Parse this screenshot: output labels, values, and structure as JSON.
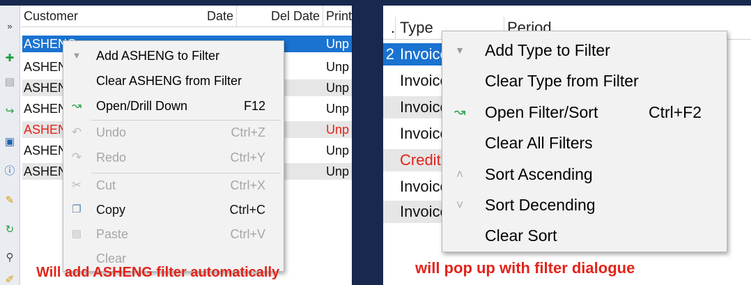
{
  "left": {
    "columns": [
      "Customer",
      "Date",
      "Del Date",
      "Print"
    ],
    "rows": [
      {
        "customer": "ASHENG",
        "print": "Unp",
        "selected": true,
        "red": false
      },
      {
        "customer": "ASHENG",
        "print": "Unp",
        "selected": false,
        "red": false
      },
      {
        "customer": "ASHENG",
        "print": "Unp",
        "selected": false,
        "red": false
      },
      {
        "customer": "ASHENG",
        "print": "Unp",
        "selected": false,
        "red": false
      },
      {
        "customer": "ASHENG",
        "print": "Unp",
        "selected": false,
        "red": true
      },
      {
        "customer": "ASHENG",
        "print": "Unp",
        "selected": false,
        "red": false
      },
      {
        "customer": "ASHENG",
        "print": "Unp",
        "selected": false,
        "red": false
      }
    ],
    "menu": {
      "add_filter": "Add ASHENG to Filter",
      "clear_filter": "Clear ASHENG from Filter",
      "open": "Open/Drill Down",
      "open_key": "F12",
      "undo": "Undo",
      "undo_key": "Ctrl+Z",
      "redo": "Redo",
      "redo_key": "Ctrl+Y",
      "cut": "Cut",
      "cut_key": "Ctrl+X",
      "copy": "Copy",
      "copy_key": "Ctrl+C",
      "paste": "Paste",
      "paste_key": "Ctrl+V",
      "clear": "Clear"
    },
    "caption": "Will add ASHENG filter automatically"
  },
  "right": {
    "columns": [
      ".",
      "Type",
      "Period"
    ],
    "rows": [
      {
        "num": "2",
        "type": "Invoice",
        "selected": true,
        "red": false
      },
      {
        "num": "",
        "type": "Invoice",
        "selected": false,
        "red": false
      },
      {
        "num": "",
        "type": "Invoice",
        "selected": false,
        "red": false
      },
      {
        "num": "",
        "type": "Invoice",
        "selected": false,
        "red": false
      },
      {
        "num": "",
        "type": "Credit",
        "selected": false,
        "red": true
      },
      {
        "num": "",
        "type": "Invoice",
        "selected": false,
        "red": false
      },
      {
        "num": "",
        "type": "Invoice",
        "selected": false,
        "red": false
      }
    ],
    "menu": {
      "add_filter": "Add Type to Filter",
      "clear_filter": "Clear Type from Filter",
      "open": "Open Filter/Sort",
      "open_key": "Ctrl+F2",
      "clear_all": "Clear All Filters",
      "sort_asc": "Sort Ascending",
      "sort_desc": "Sort Decending",
      "clear_sort": "Clear Sort"
    },
    "caption": "will pop up with filter dialogue"
  },
  "icons": {
    "filter": "filter-icon",
    "open": "green-arrow-icon",
    "undo": "undo-icon",
    "redo": "redo-icon",
    "cut": "scissors-icon",
    "copy": "copy-icon",
    "paste": "paste-icon",
    "sort_asc": "chevron-up-icon",
    "sort_desc": "chevron-down-icon"
  },
  "colors": {
    "background": "#18284e",
    "selection": "#1a73d1",
    "alt_row": "#e6e6e6",
    "alert_red": "#e2231a",
    "menu_bg": "#f2f2f2"
  }
}
